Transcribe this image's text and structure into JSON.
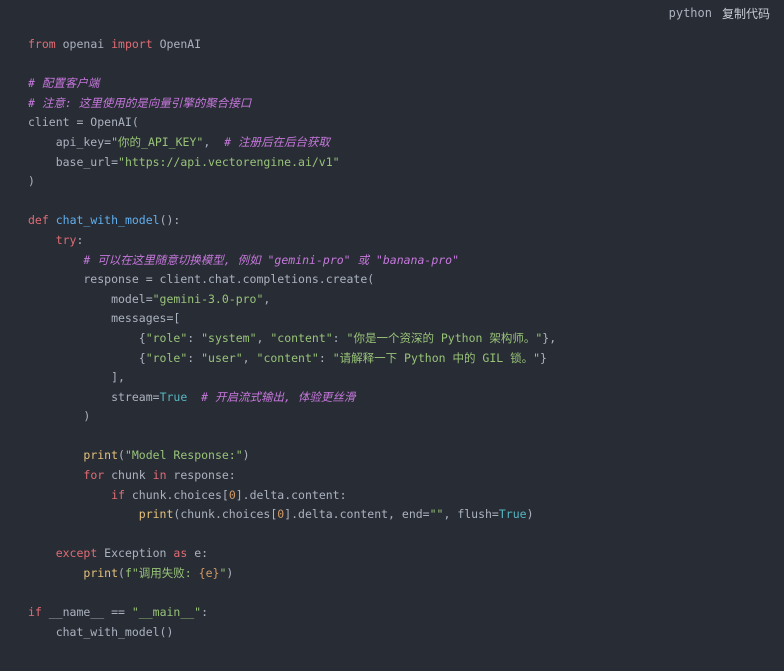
{
  "header": {
    "language": "python",
    "copy_label": "复制代码"
  },
  "code": {
    "l1": [
      {
        "t": "from",
        "c": "kw"
      },
      {
        "t": " openai ",
        "c": "pl"
      },
      {
        "t": "import",
        "c": "kw"
      },
      {
        "t": " OpenAI",
        "c": "pl"
      }
    ],
    "l2": [],
    "l3": [
      {
        "t": "# 配置客户端",
        "c": "cm"
      }
    ],
    "l4": [
      {
        "t": "# 注意: 这里使用的是向量引擎的聚合接口",
        "c": "cm"
      }
    ],
    "l5": [
      {
        "t": "client = OpenAI(",
        "c": "pl"
      }
    ],
    "l6": [
      {
        "t": "    api_key=",
        "c": "pl"
      },
      {
        "t": "\"你的_API_KEY\"",
        "c": "str"
      },
      {
        "t": ",  ",
        "c": "pl"
      },
      {
        "t": "# 注册后在后台获取",
        "c": "cm"
      }
    ],
    "l7": [
      {
        "t": "    base_url=",
        "c": "pl"
      },
      {
        "t": "\"https://api.vectorengine.ai/v1\"",
        "c": "str"
      }
    ],
    "l8": [
      {
        "t": ")",
        "c": "pl"
      }
    ],
    "l9": [],
    "l10": [
      {
        "t": "def",
        "c": "kw"
      },
      {
        "t": " ",
        "c": "pl"
      },
      {
        "t": "chat_with_model",
        "c": "fn"
      },
      {
        "t": "():",
        "c": "pl"
      }
    ],
    "l11": [
      {
        "t": "    ",
        "c": "pl"
      },
      {
        "t": "try",
        "c": "kw"
      },
      {
        "t": ":",
        "c": "pl"
      }
    ],
    "l12": [
      {
        "t": "        ",
        "c": "pl"
      },
      {
        "t": "# 可以在这里随意切换模型, 例如 \"gemini-pro\" 或 \"banana-pro\"",
        "c": "cm"
      }
    ],
    "l13": [
      {
        "t": "        response = client.chat.completions.create(",
        "c": "pl"
      }
    ],
    "l14": [
      {
        "t": "            model=",
        "c": "pl"
      },
      {
        "t": "\"gemini-3.0-pro\"",
        "c": "str"
      },
      {
        "t": ",",
        "c": "pl"
      }
    ],
    "l15": [
      {
        "t": "            messages=[",
        "c": "pl"
      }
    ],
    "l16": [
      {
        "t": "                {",
        "c": "pl"
      },
      {
        "t": "\"role\"",
        "c": "str"
      },
      {
        "t": ": ",
        "c": "pl"
      },
      {
        "t": "\"system\"",
        "c": "str"
      },
      {
        "t": ", ",
        "c": "pl"
      },
      {
        "t": "\"content\"",
        "c": "str"
      },
      {
        "t": ": ",
        "c": "pl"
      },
      {
        "t": "\"你是一个资深的 Python 架构师。\"",
        "c": "str"
      },
      {
        "t": "},",
        "c": "pl"
      }
    ],
    "l17": [
      {
        "t": "                {",
        "c": "pl"
      },
      {
        "t": "\"role\"",
        "c": "str"
      },
      {
        "t": ": ",
        "c": "pl"
      },
      {
        "t": "\"user\"",
        "c": "str"
      },
      {
        "t": ", ",
        "c": "pl"
      },
      {
        "t": "\"content\"",
        "c": "str"
      },
      {
        "t": ": ",
        "c": "pl"
      },
      {
        "t": "\"请解释一下 Python 中的 GIL 锁。\"",
        "c": "str"
      },
      {
        "t": "}",
        "c": "pl"
      }
    ],
    "l18": [
      {
        "t": "            ],",
        "c": "pl"
      }
    ],
    "l19": [
      {
        "t": "            stream=",
        "c": "pl"
      },
      {
        "t": "True",
        "c": "bool"
      },
      {
        "t": "  ",
        "c": "pl"
      },
      {
        "t": "# 开启流式输出, 体验更丝滑",
        "c": "cm"
      }
    ],
    "l20": [
      {
        "t": "        )",
        "c": "pl"
      }
    ],
    "l21": [],
    "l22": [
      {
        "t": "        ",
        "c": "pl"
      },
      {
        "t": "print",
        "c": "bi"
      },
      {
        "t": "(",
        "c": "pl"
      },
      {
        "t": "\"Model Response:\"",
        "c": "str"
      },
      {
        "t": ")",
        "c": "pl"
      }
    ],
    "l23": [
      {
        "t": "        ",
        "c": "pl"
      },
      {
        "t": "for",
        "c": "kw"
      },
      {
        "t": " chunk ",
        "c": "pl"
      },
      {
        "t": "in",
        "c": "kw"
      },
      {
        "t": " response:",
        "c": "pl"
      }
    ],
    "l24": [
      {
        "t": "            ",
        "c": "pl"
      },
      {
        "t": "if",
        "c": "kw"
      },
      {
        "t": " chunk.choices[",
        "c": "pl"
      },
      {
        "t": "0",
        "c": "num"
      },
      {
        "t": "].delta.content:",
        "c": "pl"
      }
    ],
    "l25": [
      {
        "t": "                ",
        "c": "pl"
      },
      {
        "t": "print",
        "c": "bi"
      },
      {
        "t": "(chunk.choices[",
        "c": "pl"
      },
      {
        "t": "0",
        "c": "num"
      },
      {
        "t": "].delta.content, end=",
        "c": "pl"
      },
      {
        "t": "\"\"",
        "c": "str"
      },
      {
        "t": ", flush=",
        "c": "pl"
      },
      {
        "t": "True",
        "c": "bool"
      },
      {
        "t": ")",
        "c": "pl"
      }
    ],
    "l26": [],
    "l27": [
      {
        "t": "    ",
        "c": "pl"
      },
      {
        "t": "except",
        "c": "kw"
      },
      {
        "t": " Exception ",
        "c": "pl"
      },
      {
        "t": "as",
        "c": "kw"
      },
      {
        "t": " e:",
        "c": "pl"
      }
    ],
    "l28": [
      {
        "t": "        ",
        "c": "pl"
      },
      {
        "t": "print",
        "c": "bi"
      },
      {
        "t": "(",
        "c": "pl"
      },
      {
        "t": "f\"调用失败: ",
        "c": "str"
      },
      {
        "t": "{e}",
        "c": "num"
      },
      {
        "t": "\"",
        "c": "str"
      },
      {
        "t": ")",
        "c": "pl"
      }
    ],
    "l29": [],
    "l30": [
      {
        "t": "if",
        "c": "kw"
      },
      {
        "t": " __name__ == ",
        "c": "pl"
      },
      {
        "t": "\"__main__\"",
        "c": "str"
      },
      {
        "t": ":",
        "c": "pl"
      }
    ],
    "l31": [
      {
        "t": "    chat_with_model()",
        "c": "pl"
      }
    ]
  }
}
